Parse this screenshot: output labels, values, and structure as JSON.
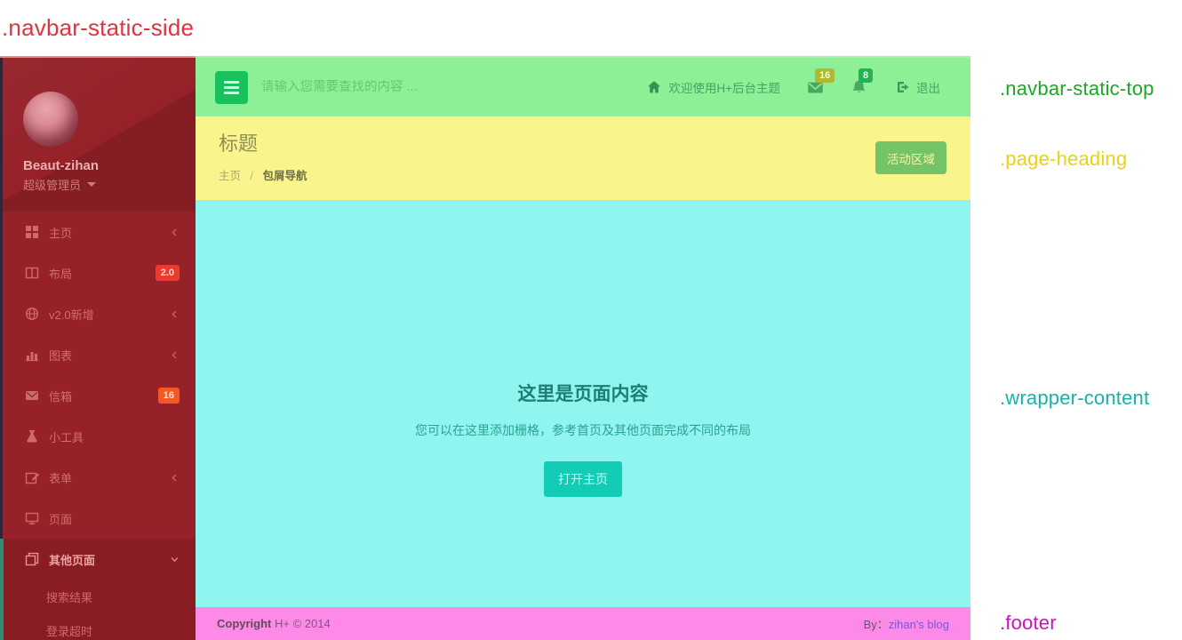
{
  "annotations": {
    "sidebar_label": ".navbar-static-side",
    "navbar_label": ".navbar-static-top",
    "heading_label": ".page-heading",
    "content_label": ".wrapper-content",
    "footer_label": ".footer"
  },
  "sidebar": {
    "user": {
      "name": "Beaut-zihan",
      "role": "超级管理员"
    },
    "items": [
      {
        "label": "主页",
        "icon": "grid-icon",
        "chevron": "left"
      },
      {
        "label": "布局",
        "icon": "columns-icon",
        "badge": "2.0"
      },
      {
        "label": "v2.0新增",
        "icon": "globe-icon",
        "chevron": "left"
      },
      {
        "label": "图表",
        "icon": "bar-chart-icon",
        "chevron": "left"
      },
      {
        "label": "信箱",
        "icon": "envelope-icon",
        "badge": "16"
      },
      {
        "label": "小工具",
        "icon": "flask-icon"
      },
      {
        "label": "表单",
        "icon": "edit-icon",
        "chevron": "left"
      },
      {
        "label": "页面",
        "icon": "desktop-icon"
      },
      {
        "label": "其他页面",
        "icon": "copy-icon",
        "chevron": "down",
        "active": true
      }
    ],
    "subitems": [
      "搜索结果",
      "登录超时"
    ]
  },
  "navbar": {
    "search_placeholder": "请输入您需要查找的内容 ...",
    "welcome": "欢迎使用H+后台主题",
    "mail_badge": "16",
    "alert_badge": "8",
    "logout": "退出"
  },
  "heading": {
    "title": "标题",
    "breadcrumb_home": "主页",
    "breadcrumb_sep": "/",
    "breadcrumb_active": "包屑导航",
    "action_button": "活动区域"
  },
  "content": {
    "title": "这里是页面内容",
    "subtitle": "您可以在这里添加栅格，参考首页及其他页面完成不同的布局",
    "button": "打开主页"
  },
  "footer": {
    "copyright_bold": "Copyright",
    "copyright_rest": " H+ © 2014",
    "by_label": "By：",
    "by_link": "zihan's blog"
  },
  "colors": {
    "sidebar_overlay": "#962129",
    "sidebar_active": "#8a1d24",
    "sidebar_active_border": "#2e8c74",
    "navbar_overlay": "#8ef096",
    "hamburger_green": "#18c15c",
    "heading_overlay": "#faf48d",
    "content_overlay": "#90f5ee",
    "footer_overlay": "#fc8ae6",
    "badge_layout": "#ee3a2c",
    "badge_mail_sidebar": "#f05a24",
    "badge_mail_navbar": "#aeb933",
    "badge_alert_navbar": "#27b156",
    "content_button": "#12ccb6",
    "heading_button": "#74c366",
    "label_side": "#dc3440",
    "label_top": "#1fa626",
    "label_heading": "#e6d414",
    "label_wrapper": "#17b3ab",
    "label_footer": "#d012b6"
  }
}
